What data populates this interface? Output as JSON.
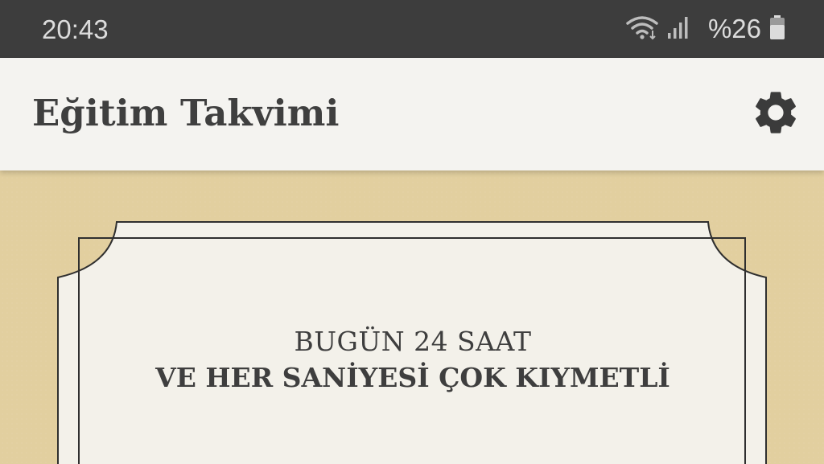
{
  "status_bar": {
    "time": "20:43",
    "battery": "%26",
    "icons": [
      "wifi-icon",
      "signal-icon",
      "battery-icon"
    ]
  },
  "app_bar": {
    "title": "Eğitim Takvimi",
    "settings_icon": "gear-icon"
  },
  "card": {
    "line1": "BUGÜN 24 SAAT",
    "line2": "VE HER SANİYESİ ÇOK KIYMETLİ"
  },
  "colors": {
    "status_bar_bg": "#3d3d3d",
    "app_bar_bg": "#f4f3f0",
    "background": "#e2cf9f",
    "card_bg": "#f3f1ea",
    "text": "#3e3e3e"
  }
}
